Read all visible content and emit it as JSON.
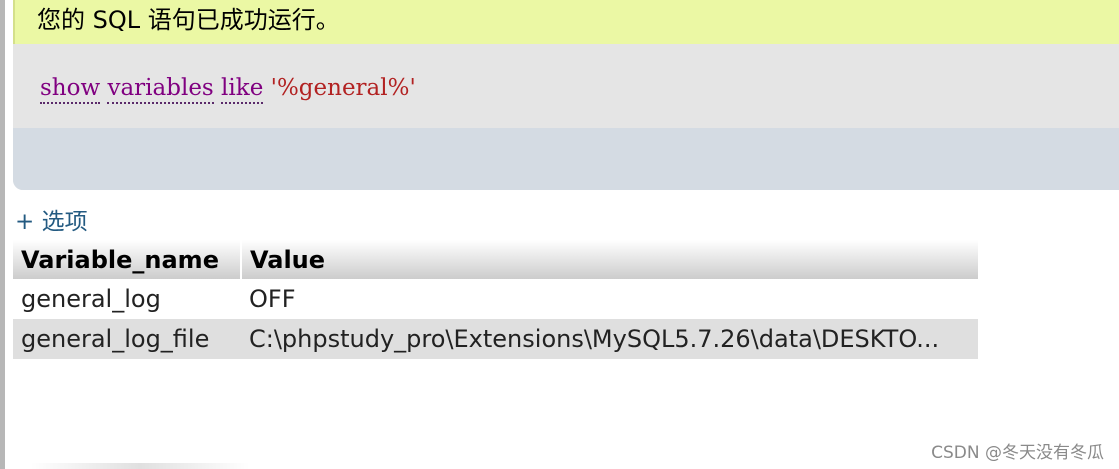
{
  "success": {
    "message": "您的 SQL 语句已成功运行。"
  },
  "sql": {
    "kw1": "show",
    "kw2": "variables",
    "kw3": "like",
    "str": "'%general%'"
  },
  "options": {
    "label": "+ 选项"
  },
  "table": {
    "headers": [
      "Variable_name",
      "Value"
    ],
    "rows": [
      [
        "general_log",
        "OFF"
      ],
      [
        "general_log_file",
        "C:\\phpstudy_pro\\Extensions\\MySQL5.7.26\\data\\DESKTO..."
      ]
    ]
  },
  "watermark": "CSDN @冬天没有冬瓜",
  "colors": {
    "success_bg": "#ebf8a4",
    "sql_panel_bg": "#e5e5e5",
    "sql_footer_bg": "#d4dbe3",
    "keyword": "#800080",
    "string": "#b22222",
    "link": "#235a81",
    "odd_row_bg": "#dfdfdf"
  }
}
